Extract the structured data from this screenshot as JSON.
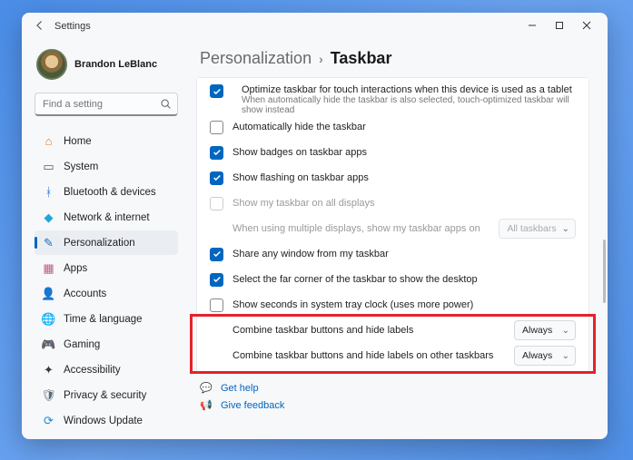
{
  "titlebar": {
    "app": "Settings"
  },
  "profile": {
    "name": "Brandon LeBlanc"
  },
  "search": {
    "placeholder": "Find a setting"
  },
  "nav": [
    {
      "label": "Home"
    },
    {
      "label": "System"
    },
    {
      "label": "Bluetooth & devices"
    },
    {
      "label": "Network & internet"
    },
    {
      "label": "Personalization"
    },
    {
      "label": "Apps"
    },
    {
      "label": "Accounts"
    },
    {
      "label": "Time & language"
    },
    {
      "label": "Gaming"
    },
    {
      "label": "Accessibility"
    },
    {
      "label": "Privacy & security"
    },
    {
      "label": "Windows Update"
    }
  ],
  "breadcrumb": {
    "parent": "Personalization",
    "current": "Taskbar"
  },
  "rows": {
    "optimize": {
      "label": "Optimize taskbar for touch interactions when this device is used as a tablet",
      "sub": "When automatically hide the taskbar is also selected, touch-optimized taskbar will show instead"
    },
    "autohide": "Automatically hide the taskbar",
    "badges": "Show badges on taskbar apps",
    "flashing": "Show flashing on taskbar apps",
    "alldisp": "Show my taskbar on all displays",
    "multi": "When using multiple displays, show my taskbar apps on",
    "multi_dd": "All taskbars",
    "share": "Share any window from my taskbar",
    "farcorner": "Select the far corner of the taskbar to show the desktop",
    "seconds": "Show seconds in system tray clock (uses more power)",
    "combine1": "Combine taskbar buttons and hide labels",
    "combine1_dd": "Always",
    "combine2": "Combine taskbar buttons and hide labels on other taskbars",
    "combine2_dd": "Always"
  },
  "footer": {
    "help": "Get help",
    "feedback": "Give feedback"
  }
}
